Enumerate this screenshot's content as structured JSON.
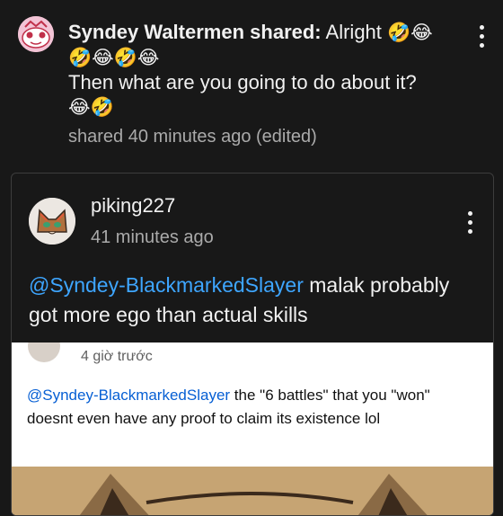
{
  "post": {
    "author": "Syndey Waltermen",
    "shared_word": "shared:",
    "message_line1": "Alright",
    "emoji_line1": "🤣😂",
    "emoji_line2": "🤣😂🤣😂",
    "message_line2": "Then what are you going to do about it?",
    "emoji_line3": "😂🤣",
    "meta": "shared 40 minutes ago (edited)"
  },
  "card": {
    "author": "piking227",
    "time": "41 minutes ago",
    "mention": "@Syndey-BlackmarkedSlayer",
    "text": " malak probably got more ego than actual skills"
  },
  "screenshot": {
    "time": "4 giờ trước",
    "mention": "@Syndey-BlackmarkedSlayer",
    "text": " the \"6 battles\" that you \"won\" doesnt even have any proof to claim its existence lol"
  },
  "colors": {
    "background": "#181818",
    "link": "#3ea6ff",
    "secondary_text": "#aaaaaa",
    "screenshot_link": "#065fd4"
  },
  "icons": {
    "post_avatar": "pink-character-avatar",
    "card_avatar": "cat-character-avatar",
    "more": "more-vertical-icon"
  }
}
